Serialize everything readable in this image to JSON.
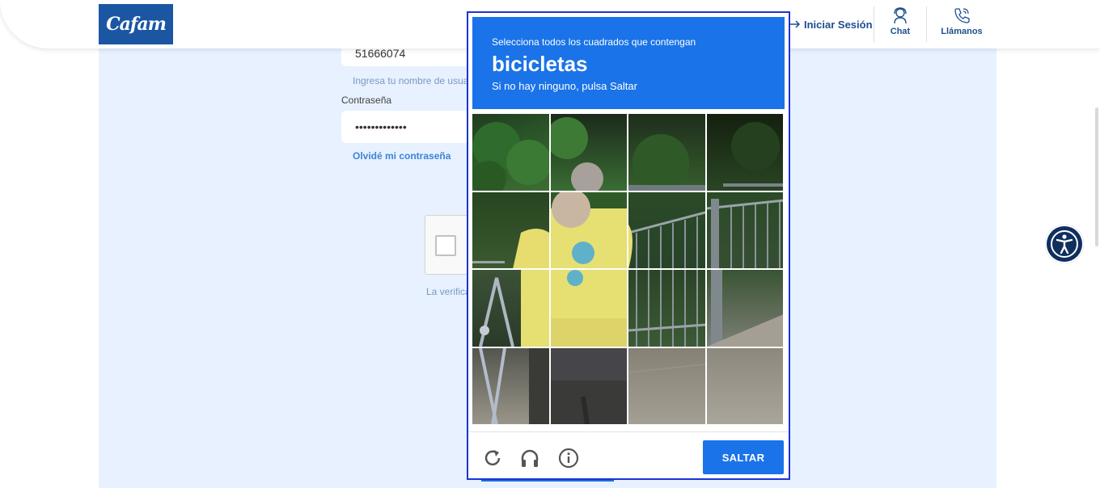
{
  "header": {
    "logo_text": "Cafam",
    "login_label": "Iniciar Sesión",
    "chat_label": "Chat",
    "call_label": "Llámanos"
  },
  "form": {
    "username_value": "51666074",
    "username_hint": "Ingresa tu nombre de usua",
    "password_label": "Contraseña",
    "password_value": "•••••••••••••",
    "forgot_label": "Olvidé mi contraseña",
    "verify_text": "La verifica"
  },
  "captcha": {
    "instruction": "Selecciona todos los cuadrados que contengan",
    "target": "bicicletas",
    "subtitle": "Si no hay ninguno, pulsa Saltar",
    "skip_label": "SALTAR",
    "reload_icon": "reload-icon",
    "audio_icon": "headphones-icon",
    "info_icon": "info-icon"
  },
  "colors": {
    "brand_blue": "#1b56a3",
    "captcha_blue": "#1a73e8",
    "panel_bg": "#e7f1ff",
    "nav_text": "#1f4f8f"
  }
}
